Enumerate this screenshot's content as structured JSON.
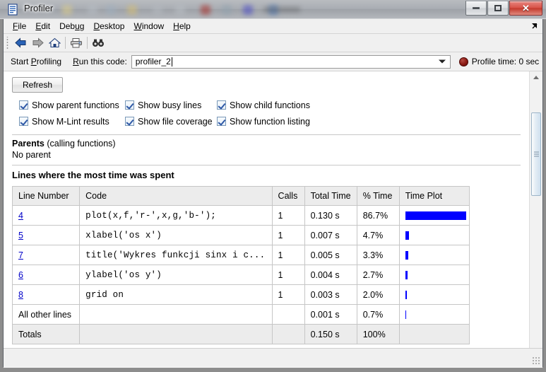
{
  "window": {
    "title": "Profiler",
    "icon": "profiler-document-icon",
    "controls": {
      "minimize": "Minimize",
      "maximize": "Maximize",
      "close": "Close"
    }
  },
  "menubar": {
    "items": [
      {
        "label": "File",
        "pre": "",
        "mnemonic": "F",
        "post": "ile"
      },
      {
        "label": "Edit",
        "pre": "",
        "mnemonic": "E",
        "post": "dit"
      },
      {
        "label": "Debug",
        "pre": "Deb",
        "mnemonic": "u",
        "post": "g"
      },
      {
        "label": "Desktop",
        "pre": "",
        "mnemonic": "D",
        "post": "esktop"
      },
      {
        "label": "Window",
        "pre": "",
        "mnemonic": "W",
        "post": "indow"
      },
      {
        "label": "Help",
        "pre": "",
        "mnemonic": "H",
        "post": "elp"
      }
    ],
    "undock_icon": "undock-arrow-icon"
  },
  "toolbar": {
    "buttons": [
      {
        "name": "back-icon",
        "tip": "Back"
      },
      {
        "name": "forward-icon",
        "tip": "Forward"
      },
      {
        "name": "home-icon",
        "tip": "Home"
      },
      {
        "name": "print-icon",
        "tip": "Print"
      },
      {
        "name": "find-icon",
        "tip": "Find"
      }
    ]
  },
  "profiling_bar": {
    "start_profiling": {
      "pre": "Start ",
      "mnemonic": "P",
      "post": "rofiling"
    },
    "run_this_code": {
      "pre": "",
      "mnemonic": "R",
      "post": "un this code:"
    },
    "code_value": "profiler_2",
    "code_placeholder": "",
    "dropdown_icon": "chevron-down-icon",
    "profile_time_label": "Profile time: 0 sec",
    "profile_time_icon": "red-stop-ball-icon"
  },
  "content": {
    "refresh_label": "Refresh",
    "checkboxes": [
      {
        "label": "Show parent functions",
        "checked": true
      },
      {
        "label": "Show busy lines",
        "checked": true
      },
      {
        "label": "Show child functions",
        "checked": true
      },
      {
        "label": "Show M-Lint results",
        "checked": true
      },
      {
        "label": "Show file coverage",
        "checked": true
      },
      {
        "label": "Show function listing",
        "checked": true
      }
    ],
    "parents_heading_bold": "Parents",
    "parents_heading_rest": " (calling functions)",
    "parents_value": "No parent",
    "lines_heading": "Lines where the most time was spent",
    "table": {
      "columns": [
        "Line Number",
        "Code",
        "Calls",
        "Total Time",
        "% Time",
        "Time Plot"
      ],
      "rows": [
        {
          "line": "4",
          "link": true,
          "code": "plot(x,f,'r-',x,g,'b-');",
          "calls": "1",
          "total_time": "0.130 s",
          "pct": "86.7%",
          "bar_pct": 86.7
        },
        {
          "line": "5",
          "link": true,
          "code": "xlabel('os x')",
          "calls": "1",
          "total_time": "0.007 s",
          "pct": "4.7%",
          "bar_pct": 4.7
        },
        {
          "line": "7",
          "link": true,
          "code": "title('Wykres funkcji sinx i c...",
          "calls": "1",
          "total_time": "0.005 s",
          "pct": "3.3%",
          "bar_pct": 3.6
        },
        {
          "line": "6",
          "link": true,
          "code": "ylabel('os y')",
          "calls": "1",
          "total_time": "0.004 s",
          "pct": "2.7%",
          "bar_pct": 3.4
        },
        {
          "line": "8",
          "link": true,
          "code": "grid on",
          "calls": "1",
          "total_time": "0.003 s",
          "pct": "2.0%",
          "bar_pct": 2.4
        },
        {
          "line": "All other lines",
          "link": false,
          "code": "",
          "calls": "",
          "total_time": "0.001 s",
          "pct": "0.7%",
          "bar_pct": 1.0
        },
        {
          "line": "Totals",
          "link": false,
          "code": "",
          "calls": "",
          "total_time": "0.150 s",
          "pct": "100%",
          "bar_pct": 0,
          "is_total": true
        }
      ]
    }
  },
  "colors": {
    "bar": "#0000ff",
    "link": "#0000c8",
    "header_bg": "#ececec",
    "close_button": "#c43a2d"
  },
  "chart_data": {
    "type": "bar",
    "title": "Time Plot",
    "categories": [
      "4",
      "5",
      "7",
      "6",
      "8",
      "All other lines"
    ],
    "values": [
      86.7,
      4.7,
      3.3,
      2.7,
      2.0,
      0.7
    ],
    "xlabel": "Line Number",
    "ylabel": "% Time",
    "ylim": [
      0,
      100
    ],
    "grid": false,
    "legend": "none"
  }
}
